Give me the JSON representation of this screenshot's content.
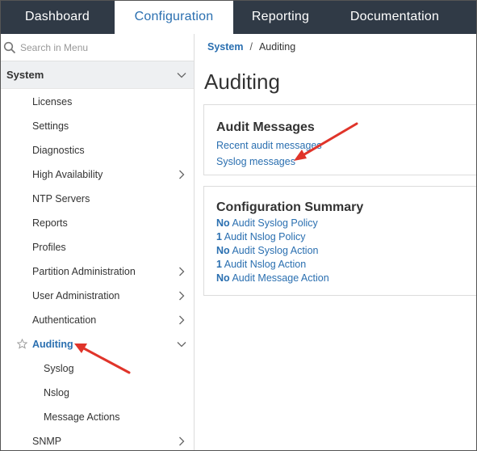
{
  "topnav": {
    "tabs": [
      {
        "label": "Dashboard",
        "active": false
      },
      {
        "label": "Configuration",
        "active": true
      },
      {
        "label": "Reporting",
        "active": false
      },
      {
        "label": "Documentation",
        "active": false
      }
    ]
  },
  "sidebar": {
    "search_placeholder": "Search in Menu",
    "section": "System",
    "items": [
      {
        "label": "Licenses"
      },
      {
        "label": "Settings"
      },
      {
        "label": "Diagnostics"
      },
      {
        "label": "High Availability"
      },
      {
        "label": "NTP Servers"
      },
      {
        "label": "Reports"
      },
      {
        "label": "Profiles"
      },
      {
        "label": "Partition Administration"
      },
      {
        "label": "User Administration"
      },
      {
        "label": "Authentication"
      },
      {
        "label": "Auditing"
      },
      {
        "label": "Syslog"
      },
      {
        "label": "Nslog"
      },
      {
        "label": "Message Actions"
      },
      {
        "label": "SNMP"
      }
    ]
  },
  "breadcrumb": {
    "parent": "System",
    "separator": "/",
    "current": "Auditing"
  },
  "page_title": "Auditing",
  "audit_messages": {
    "title": "Audit Messages",
    "links": [
      "Recent audit messages",
      "Syslog messages"
    ]
  },
  "config_summary": {
    "title": "Configuration Summary",
    "rows": [
      {
        "count": "No",
        "label": "Audit Syslog Policy"
      },
      {
        "count": "1",
        "label": "Audit Nslog Policy"
      },
      {
        "count": "No",
        "label": "Audit Syslog Action"
      },
      {
        "count": "1",
        "label": "Audit Nslog Action"
      },
      {
        "count": "No",
        "label": "Audit Message Action"
      }
    ]
  },
  "colors": {
    "nav_bg": "#303a46",
    "link": "#2a6fb0",
    "arrow": "#e0342a"
  }
}
